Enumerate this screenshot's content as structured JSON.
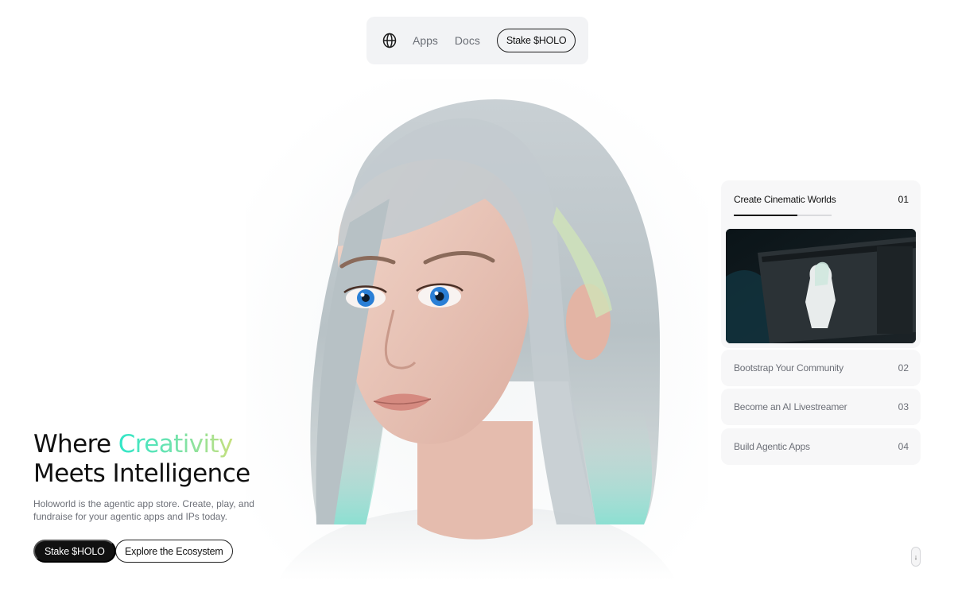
{
  "nav": {
    "items": [
      {
        "label": "Apps"
      },
      {
        "label": "Docs"
      }
    ],
    "stake_label": "Stake $HOLO",
    "logo_icon": "holoworld-logo-icon"
  },
  "hero": {
    "headline_part1": "Where ",
    "headline_accent": "Creativity",
    "headline_line2": "Meets Intelligence",
    "subtext": "Holoworld is the agentic app store. Create, play, and fundraise for your agentic apps and IPs today.",
    "primary_button": "Stake $HOLO",
    "secondary_button": "Explore the Ecosystem",
    "accent_gradient": [
      "#31e6c8",
      "#6be3b0",
      "#c7e07d"
    ],
    "image_icon": "ai-avatar-portrait"
  },
  "features": {
    "items": [
      {
        "title": "Create Cinematic Worlds",
        "number": "01",
        "active": true,
        "progress": 0.65
      },
      {
        "title": "Bootstrap Your Community",
        "number": "02",
        "active": false
      },
      {
        "title": "Become an AI Livestreamer",
        "number": "03",
        "active": false
      },
      {
        "title": "Build Agentic Apps",
        "number": "04",
        "active": false
      }
    ]
  },
  "scroll_indicator": {
    "glyph": "↓"
  }
}
